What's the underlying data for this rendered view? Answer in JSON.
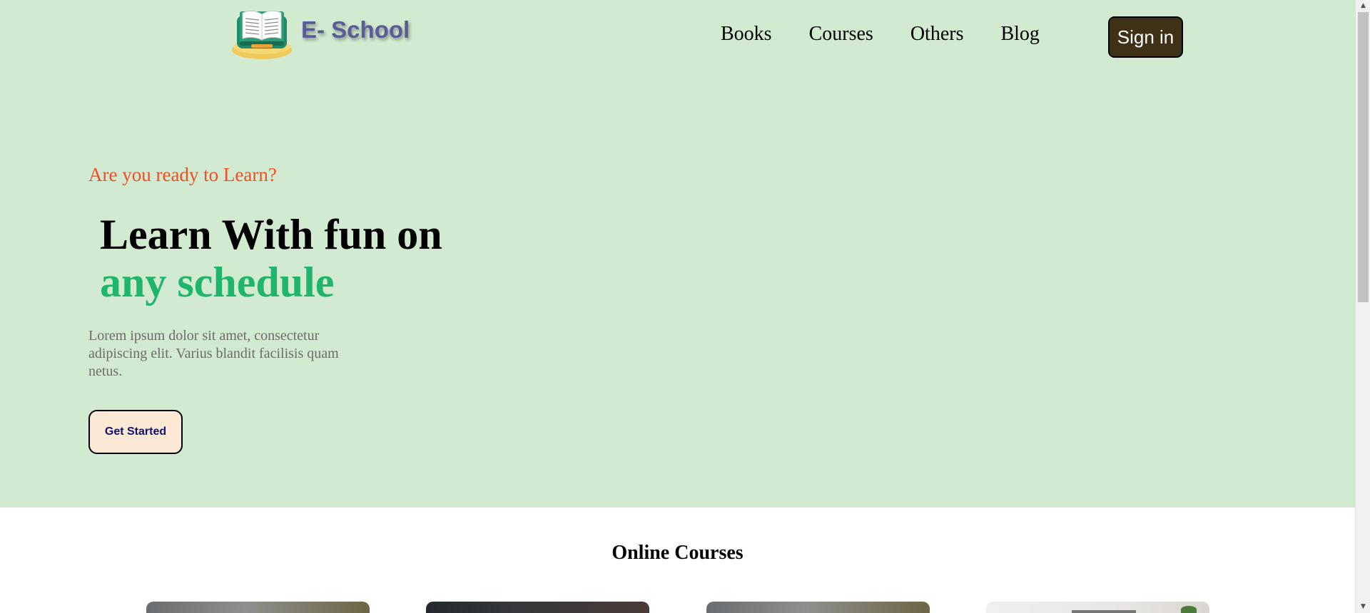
{
  "header": {
    "logo_text": "E- School",
    "nav": [
      "Books",
      "Courses",
      "Others",
      "Blog"
    ],
    "signin_label": "Sign in"
  },
  "hero": {
    "tagline": "Are you ready to Learn?",
    "headline_line1": "Learn With fun on",
    "headline_line2": "any schedule",
    "description": "Lorem ipsum dolor sit amet, consectetur adipiscing elit. Varius blandit facilisis quam netus.",
    "cta_label": "Get Started"
  },
  "courses": {
    "title": "Online Courses"
  },
  "scrollbar": {
    "up_icon": "▲",
    "down_icon": "▼"
  },
  "colors": {
    "hero_bg": "#d1ead0",
    "tagline": "#ef4f24",
    "accent_green": "#20b56c",
    "signin_bg": "#3e3115",
    "cta_bg": "#fbe9d5",
    "logo_text": "#5a5c97"
  }
}
